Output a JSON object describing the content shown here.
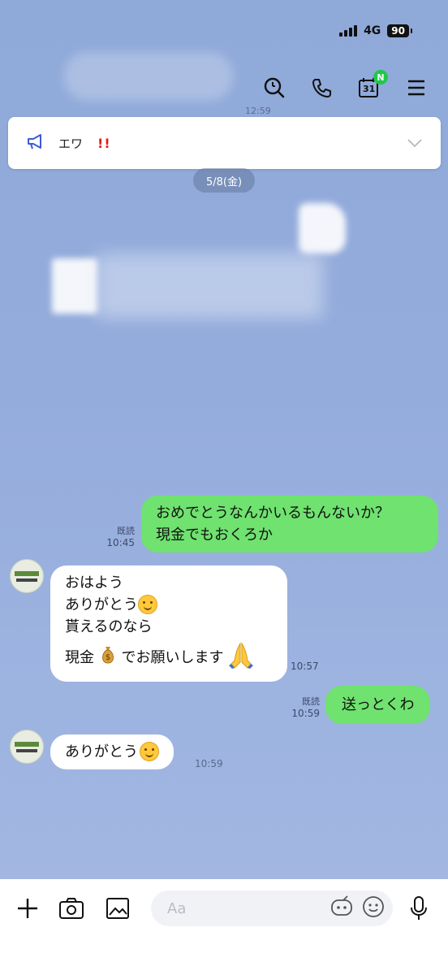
{
  "status_bar": {
    "network": "4G",
    "battery": "90"
  },
  "header": {
    "calendar_day": "31",
    "calendar_badge": "N"
  },
  "announcement": {
    "text": "エワ",
    "mark": "!!"
  },
  "date_separator": "5/8(金)",
  "faded_time": "12:59",
  "messages": [
    {
      "side": "right",
      "read": "既読",
      "time": "10:45",
      "lines": [
        "おめでとうなんかいるもんないか？",
        "現金でもおくろか"
      ]
    },
    {
      "side": "left",
      "time": "10:57",
      "lines": [
        "おはよう",
        "ありがとう",
        "貰えるのなら",
        "現金",
        "でお願いします"
      ]
    },
    {
      "side": "right",
      "read": "既読",
      "time": "10:59",
      "lines": [
        "送っとくわ"
      ]
    },
    {
      "side": "left",
      "time": "10:59",
      "lines": [
        "ありがとう"
      ]
    }
  ],
  "input": {
    "placeholder": "Aa"
  },
  "icons": [
    "search-icon",
    "phone-icon",
    "calendar-icon",
    "menu-icon",
    "megaphone-icon",
    "chevron-down-icon",
    "plus-icon",
    "camera-icon",
    "image-icon",
    "sticker-icon",
    "emoji-icon",
    "mic-icon",
    "money-bag-icon",
    "pray-icon",
    "smile-icon"
  ]
}
